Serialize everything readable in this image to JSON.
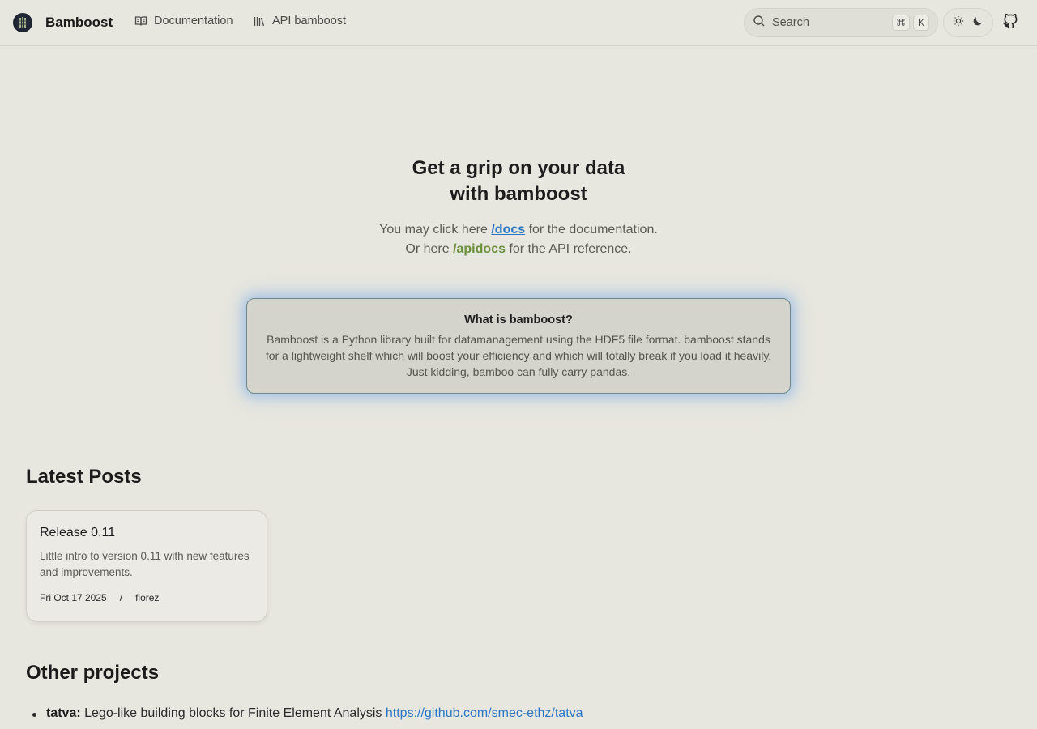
{
  "nav": {
    "brand": "Bamboost",
    "links": [
      {
        "label": "Documentation",
        "icon": "book-open-icon"
      },
      {
        "label": "API bamboost",
        "icon": "library-icon"
      }
    ],
    "search": {
      "placeholder": "Search",
      "shortcut_mod": "⌘",
      "shortcut_key": "K"
    },
    "theme_toggle": {
      "light_icon": "sun-icon",
      "dark_icon": "moon-icon"
    },
    "github_icon": "github-icon"
  },
  "hero": {
    "title_line1": "Get a grip on your data",
    "title_line2": "with bamboost",
    "line1_prefix": "You may click here ",
    "docs_link": "/docs",
    "line1_suffix": " for the documentation.",
    "line2_prefix": "Or here ",
    "api_link": "/apidocs",
    "line2_suffix": " for the API reference."
  },
  "about": {
    "title": "What is bamboost?",
    "text": "Bamboost is a Python library built for datamanagement using the HDF5 file format. bamboost stands for a lightweight shelf which will boost your efficiency and which will totally break if you load it heavily. Just kidding, bamboo can fully carry pandas."
  },
  "latest_posts": {
    "heading": "Latest Posts",
    "posts": [
      {
        "title": "Release 0.11",
        "description": "Little intro to version 0.11 with new features and improvements.",
        "date": "Fri Oct 17 2025",
        "separator": "/",
        "author": "florez"
      }
    ]
  },
  "other_projects": {
    "heading": "Other projects",
    "items": [
      {
        "name": "tatva:",
        "description": " Lego-like building blocks for Finite Element Analysis ",
        "url": "https://github.com/smec-ethz/tatva"
      }
    ]
  },
  "colors": {
    "background": "#e8e7df",
    "link_docs": "#2b77c4",
    "link_api": "#6b8f3b",
    "card_glow": "#78aae6"
  }
}
